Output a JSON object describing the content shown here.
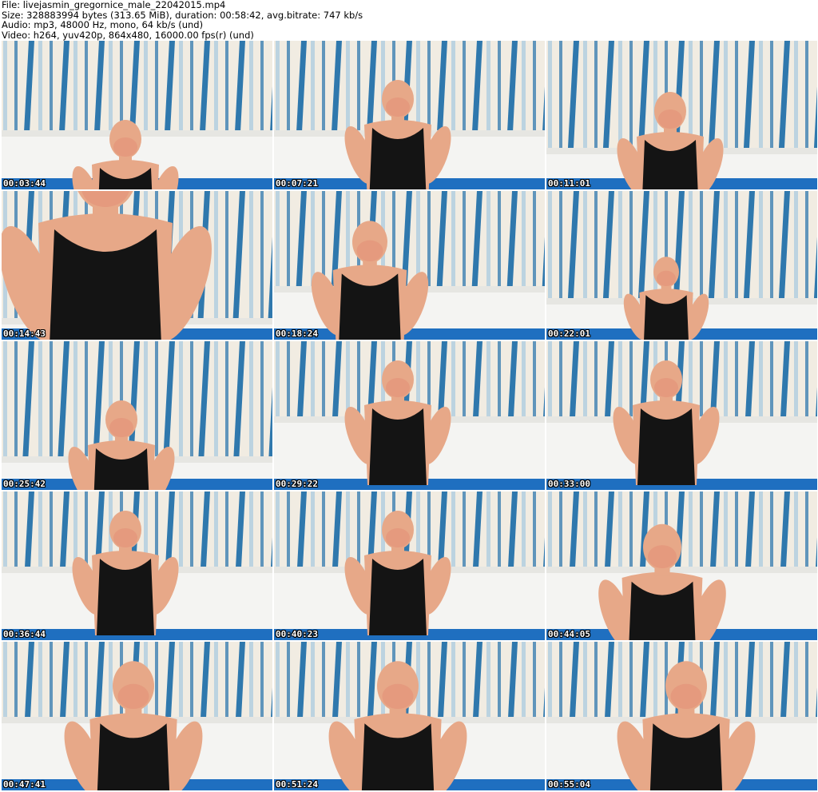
{
  "header": {
    "line1": "File: livejasmin_gregornice_male_22042015.mp4",
    "line2": "Size: 328883994 bytes (313.65 MiB), duration: 00:58:42, avg.bitrate: 747 kb/s",
    "line3": "Audio: mp3, 48000 Hz, mono, 64 kb/s (und)",
    "line4": "Video: h264, yuv420p, 864x480, 16000.00 fps(r) (und)"
  },
  "thumbnails": [
    {
      "timestamp": "00:03:44"
    },
    {
      "timestamp": "00:07:21"
    },
    {
      "timestamp": "00:11:01"
    },
    {
      "timestamp": "00:14:43"
    },
    {
      "timestamp": "00:18:24"
    },
    {
      "timestamp": "00:22:01"
    },
    {
      "timestamp": "00:25:42"
    },
    {
      "timestamp": "00:29:22"
    },
    {
      "timestamp": "00:33:00"
    },
    {
      "timestamp": "00:36:44"
    },
    {
      "timestamp": "00:40:23"
    },
    {
      "timestamp": "00:44:05"
    },
    {
      "timestamp": "00:47:41"
    },
    {
      "timestamp": "00:51:24"
    },
    {
      "timestamp": "00:55:04"
    }
  ],
  "colors": {
    "wall": "#f1ece2",
    "stripe_blue": "#2f78ad",
    "stripe_light": "#bcd3e0",
    "sofa": "#f4f4f2",
    "blanket": "#1f6fc0",
    "skin": "#e7a888",
    "shirt": "#141414"
  }
}
